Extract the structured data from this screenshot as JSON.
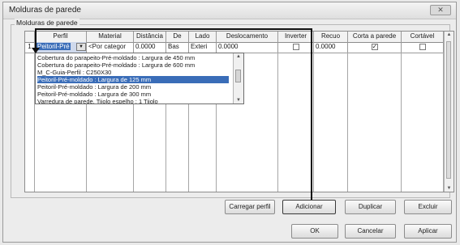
{
  "window": {
    "title": "Molduras de parede",
    "close_label": "✕"
  },
  "group": {
    "label": "Molduras de parede"
  },
  "table": {
    "headers": [
      "",
      "Perfil",
      "Material",
      "Distância",
      "De",
      "Lado",
      "Deslocamento",
      "Inverter",
      "Recuo",
      "Corta a parede",
      "Cortável"
    ],
    "row": {
      "index": "1",
      "perfil": "Peitoril-Pré",
      "material": "<Por categor",
      "distancia": "0.0000",
      "de": "Bas",
      "lado": "Exteri",
      "deslocamento": "0.0000",
      "inverter": false,
      "recuo": "0.0000",
      "corta_parede": true,
      "cortavel": false
    }
  },
  "dropdown": {
    "items": [
      "Cobertura do parapeito-Pré-moldado : Largura de 450 mm",
      "Cobertura do parapeito-Pré-moldado : Largura de 600 mm",
      "M_C-Guia-Perfil : C250X30",
      "Peitoril-Pré-moldado : Largura de 125 mm",
      "Peitoril-Pré-moldado : Largura de 200 mm",
      "Peitoril-Pré-moldado : Largura de 300 mm",
      "Varredura de parede, Tijolo espelho : 1 Tijolo"
    ],
    "selected_index": 3
  },
  "buttons": {
    "carregar": "Carregar perfil",
    "adicionar": "Adicionar",
    "duplicar": "Duplicar",
    "excluir": "Excluir",
    "ok": "OK",
    "cancelar": "Cancelar",
    "aplicar": "Aplicar"
  }
}
